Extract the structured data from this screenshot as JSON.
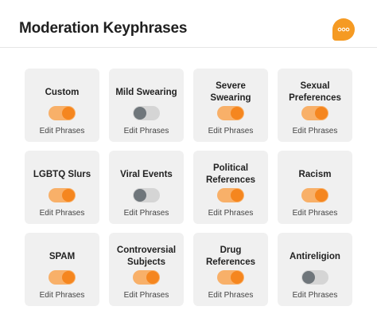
{
  "header": {
    "title": "Moderation Keyphrases",
    "icon": "chat-bubble-icon",
    "accent_color": "#f59a23"
  },
  "colors": {
    "toggle_on_track": "#f8b069",
    "toggle_on_knob": "#f5861f",
    "toggle_off_track": "#d5d5d5",
    "toggle_off_knob": "#6f767b",
    "card_background": "#f0f0f0"
  },
  "categories": [
    {
      "label": "Custom",
      "enabled": true,
      "action": "Edit Phrases"
    },
    {
      "label": "Mild Swearing",
      "enabled": false,
      "action": "Edit Phrases"
    },
    {
      "label": "Severe Swearing",
      "enabled": true,
      "action": "Edit Phrases"
    },
    {
      "label": "Sexual Preferences",
      "enabled": true,
      "action": "Edit Phrases"
    },
    {
      "label": "LGBTQ Slurs",
      "enabled": true,
      "action": "Edit Phrases"
    },
    {
      "label": "Viral Events",
      "enabled": false,
      "action": "Edit Phrases"
    },
    {
      "label": "Political References",
      "enabled": true,
      "action": "Edit Phrases"
    },
    {
      "label": "Racism",
      "enabled": true,
      "action": "Edit Phrases"
    },
    {
      "label": "SPAM",
      "enabled": true,
      "action": "Edit Phrases"
    },
    {
      "label": "Controversial Subjects",
      "enabled": true,
      "action": "Edit Phrases"
    },
    {
      "label": "Drug References",
      "enabled": true,
      "action": "Edit Phrases"
    },
    {
      "label": "Antireligion",
      "enabled": false,
      "action": "Edit Phrases"
    }
  ]
}
